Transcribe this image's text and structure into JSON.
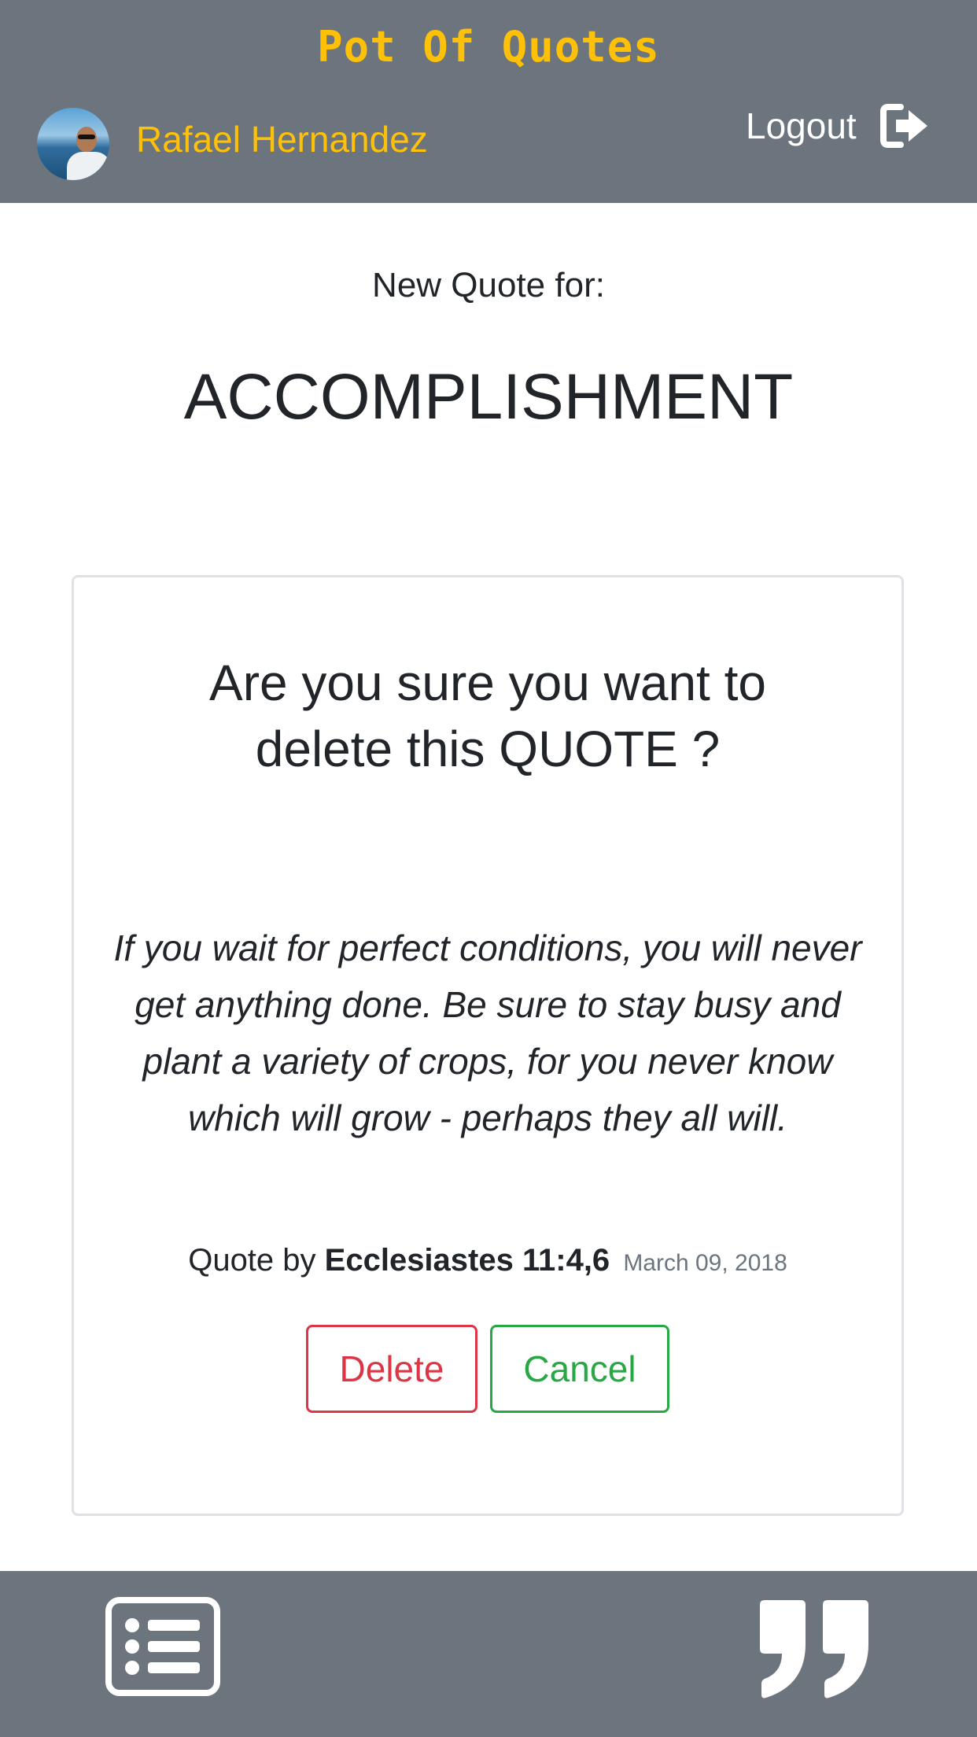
{
  "header": {
    "brand": "Pot Of Quotes",
    "user_name": "Rafael Hernandez",
    "logout_label": "Logout",
    "logout_icon": "sign-out-icon",
    "avatar": "user-avatar-photo"
  },
  "main": {
    "subtitle": "New Quote for:",
    "category": "ACCOMPLISHMENT"
  },
  "dialog": {
    "title_line1": "Are you sure you want to",
    "title_line2": "delete this QUOTE ?",
    "quote": "If you wait for perfect conditions, you will never get anything done. Be sure to stay busy and plant a variety of crops, for you never know which will grow - perhaps they all will.",
    "quote_by_label": "Quote by",
    "author": "Ecclesiastes 11:4,6",
    "date": "March 09, 2018",
    "delete_label": "Delete",
    "cancel_label": "Cancel"
  },
  "footer": {
    "left_icon": "list-icon",
    "right_icon": "quote-icon"
  },
  "colors": {
    "bar": "#6c757d",
    "accent": "#ffc107",
    "danger": "#dc3545",
    "success": "#28a745",
    "text": "#212529"
  }
}
